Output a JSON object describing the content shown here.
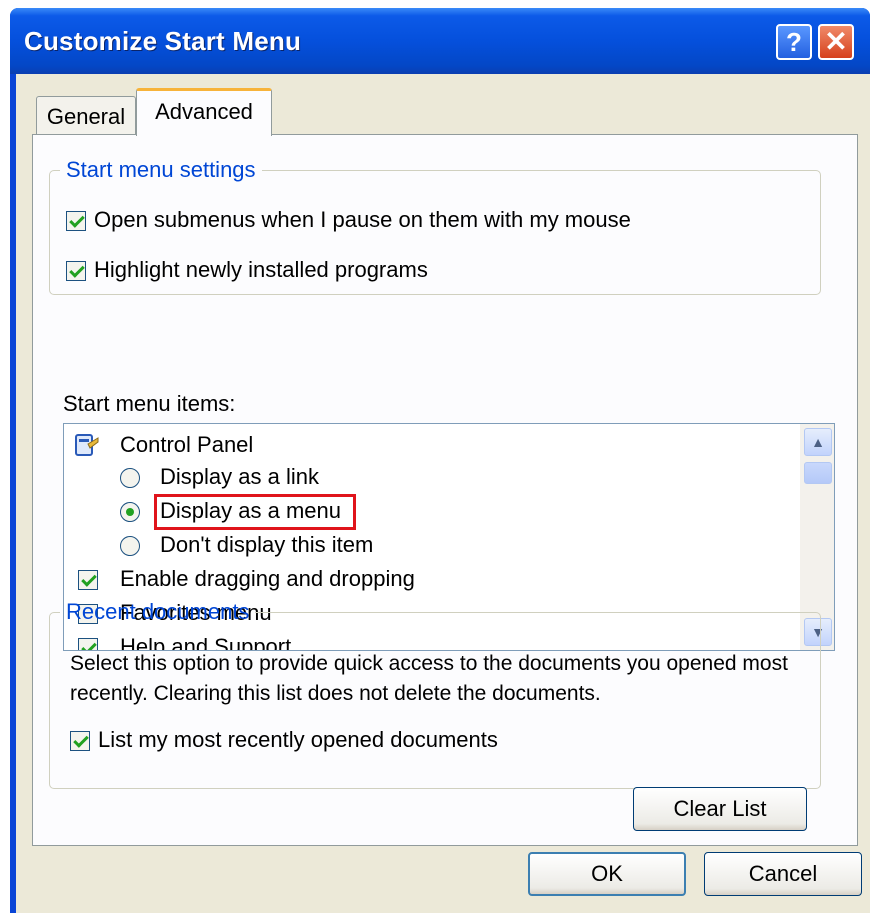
{
  "window": {
    "title": "Customize Start Menu",
    "help_glyph": "?",
    "close_glyph": "✕"
  },
  "tabs": [
    {
      "label": "General",
      "active": false
    },
    {
      "label": "Advanced",
      "active": true
    }
  ],
  "start_menu_settings": {
    "legend": "Start menu settings",
    "options": [
      {
        "label": "Open submenus when I pause on them with my mouse",
        "checked": true
      },
      {
        "label": "Highlight newly installed programs",
        "checked": true
      }
    ]
  },
  "start_menu_items": {
    "label": "Start menu items:",
    "control_panel": {
      "label": "Control Panel",
      "icon": "control-panel-icon",
      "options": [
        {
          "label": "Display as a link",
          "selected": false
        },
        {
          "label": "Display as a menu",
          "selected": true
        },
        {
          "label": "Don't display this item",
          "selected": false
        }
      ]
    },
    "items": [
      {
        "label": "Enable dragging and dropping",
        "checked": true
      },
      {
        "label": "Favorites menu",
        "checked": false
      },
      {
        "label": "Help and Support",
        "checked": true
      }
    ]
  },
  "recent_documents": {
    "legend": "Recent documents",
    "description": "Select this option to provide quick access to the documents you opened most recently.  Clearing this list does not delete the documents.",
    "option": {
      "label": "List my most recently opened documents",
      "checked": true
    },
    "clear_button": "Clear List"
  },
  "buttons": {
    "ok": "OK",
    "cancel": "Cancel"
  },
  "colors": {
    "accent_blue": "#0046d5",
    "highlight_red": "#e0141b",
    "check_green": "#21a121"
  }
}
